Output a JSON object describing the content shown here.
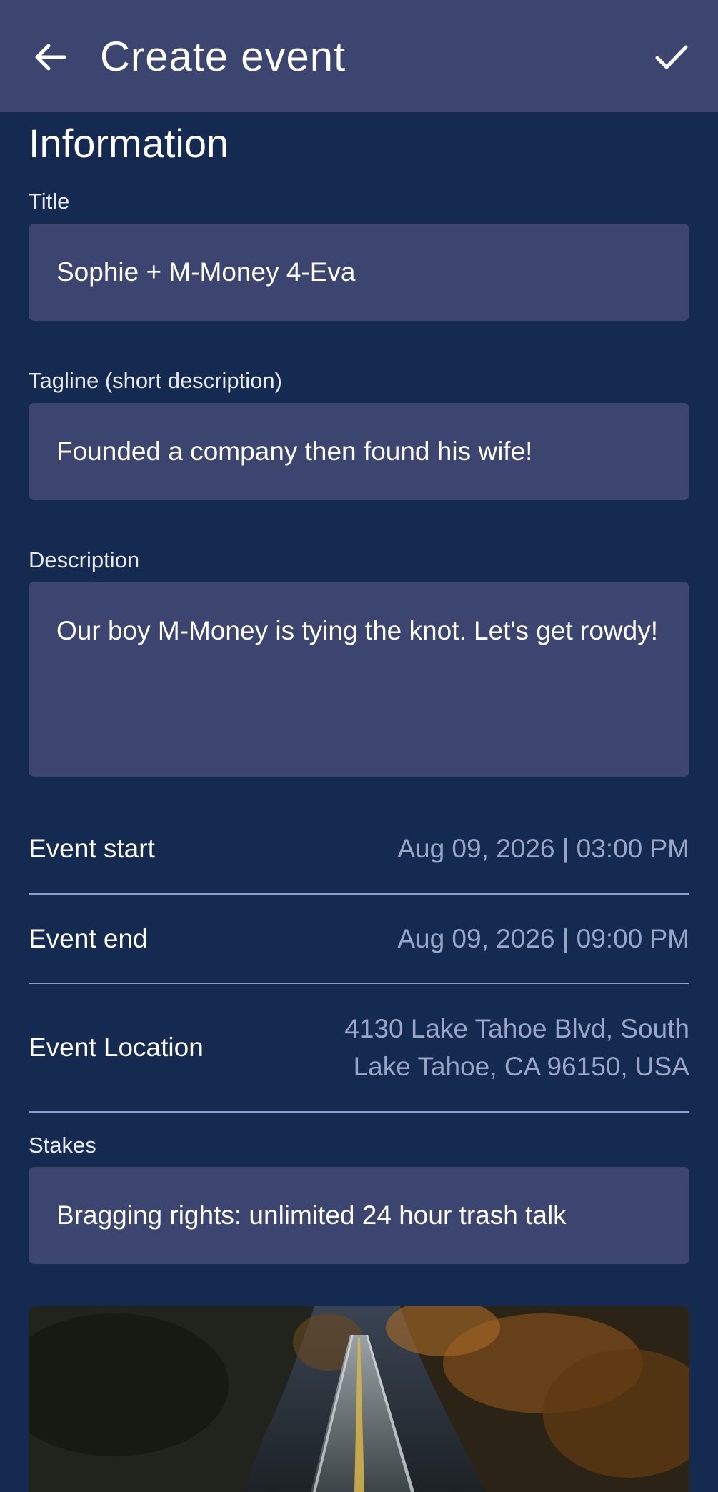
{
  "appbar": {
    "title": "Create event",
    "back_icon": "arrow-left-icon",
    "save_icon": "checkmark-icon"
  },
  "section": {
    "title": "Information"
  },
  "fields": {
    "title": {
      "label": "Title",
      "value": "Sophie + M-Money 4-Eva"
    },
    "tagline": {
      "label": "Tagline (short description)",
      "value": "Founded a company then found his wife!"
    },
    "description": {
      "label": "Description",
      "value": "Our boy M-Money is tying the knot. Let's get rowdy!"
    },
    "stakes": {
      "label": "Stakes",
      "value": "Bragging rights: unlimited 24 hour trash talk"
    }
  },
  "rows": {
    "start": {
      "label": "Event start",
      "value": "Aug 09, 2026 | 03:00 PM"
    },
    "end": {
      "label": "Event end",
      "value": "Aug 09, 2026 | 09:00 PM"
    },
    "location": {
      "label": "Event Location",
      "line1": "4130 Lake Tahoe Blvd, South",
      "line2": "Lake Tahoe, CA 96150, USA"
    }
  },
  "colors": {
    "background": "#152a50",
    "surface": "#3b4570",
    "divider": "#8a9fd0",
    "muted_text": "#9aa6c8"
  },
  "photo": {
    "subject": "road-through-autumn-forest-image"
  }
}
